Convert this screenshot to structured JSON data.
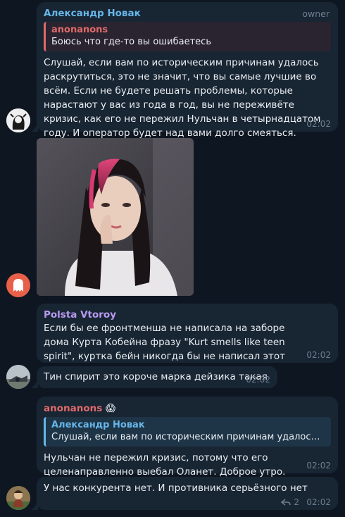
{
  "messages": [
    {
      "sender": "Александр Новак",
      "role": "owner",
      "reply_to": {
        "name": "anonanons",
        "text": "Боюсь что где-то вы ошибаетесь"
      },
      "text": "Слушай, если вам по историческим причинам удалось раскрутиться, это не значит, что вы самые лучшие во всём. Если не будете решать проблемы, которые нарастают у вас из года в год, вы не переживёте кризис, как его не пережил Нульчан в четырнадцатом году. И оператор будет над вами долго смеяться.",
      "time": "02:02"
    },
    {
      "sender": "Polsta Vtoroy",
      "text": "Если бы ее фронтменша не написала на заборе дома Курта Кобейна фразу \"Kurt smells like teen spirit\", куртка бейн никогда бы не написал этот трек",
      "time": "02:02"
    },
    {
      "text": "Тин спирит это короче марка дейзика такая",
      "time": "02:02"
    },
    {
      "sender": "anonanons",
      "emoji": "😱",
      "reply_to": {
        "name": "Александр Новак",
        "text": "Слушай, если вам по историческим причинам удалось раск..."
      },
      "text": "Нульчан не пережил кризис, потому что его целенаправленно выебал Оланет. Доброе утро.",
      "time": "02:02"
    },
    {
      "text": "У нас конкурента нет. И противника серьёзного нет",
      "replies": "2",
      "time": "02:02"
    }
  ],
  "colors": {
    "background": "#0e1621",
    "bubble": "#182533",
    "novak_name": "#67b7e8",
    "anonanons_name": "#e06a6a",
    "polsta_name": "#b99af0",
    "meta": "#6d7f8f"
  }
}
